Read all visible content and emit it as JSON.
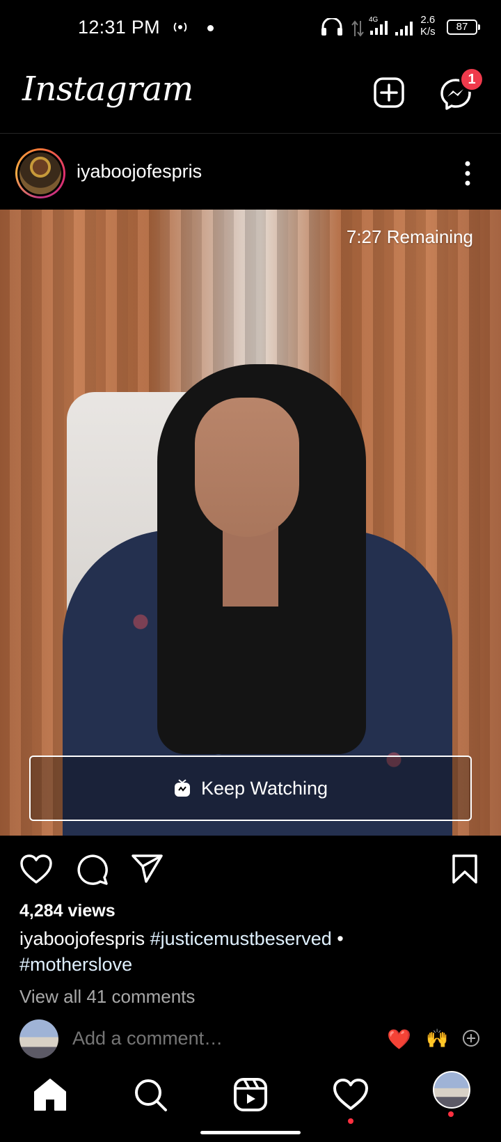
{
  "status_bar": {
    "time": "12:31 PM",
    "network_type": "4G",
    "speed_value": "2.6",
    "speed_unit": "K/s",
    "battery": "87"
  },
  "header": {
    "logo": "Instagram",
    "messages_badge": "1"
  },
  "post": {
    "username": "iyaboojofespris",
    "remaining": "7:27 Remaining",
    "keep_watching": "Keep Watching",
    "views": "4,284 views",
    "caption_user": "iyaboojofespris",
    "caption_tag1": "#justicemustbeserved",
    "caption_sep": "•",
    "caption_tag2": "#motherslove",
    "view_comments": "View all 41 comments",
    "comment_placeholder": "Add a comment…",
    "quick_reactions": [
      "❤️",
      "🙌"
    ]
  },
  "icons": [
    "plus-square-icon",
    "messenger-icon",
    "more-vertical-icon",
    "heart-icon",
    "comment-icon",
    "share-icon",
    "bookmark-icon",
    "home-icon",
    "search-icon",
    "reels-icon",
    "activity-icon"
  ],
  "colors": {
    "badge": "#ef3a4c",
    "notification_dot": "#ff3040",
    "muted_text": "#a8a8a8"
  }
}
